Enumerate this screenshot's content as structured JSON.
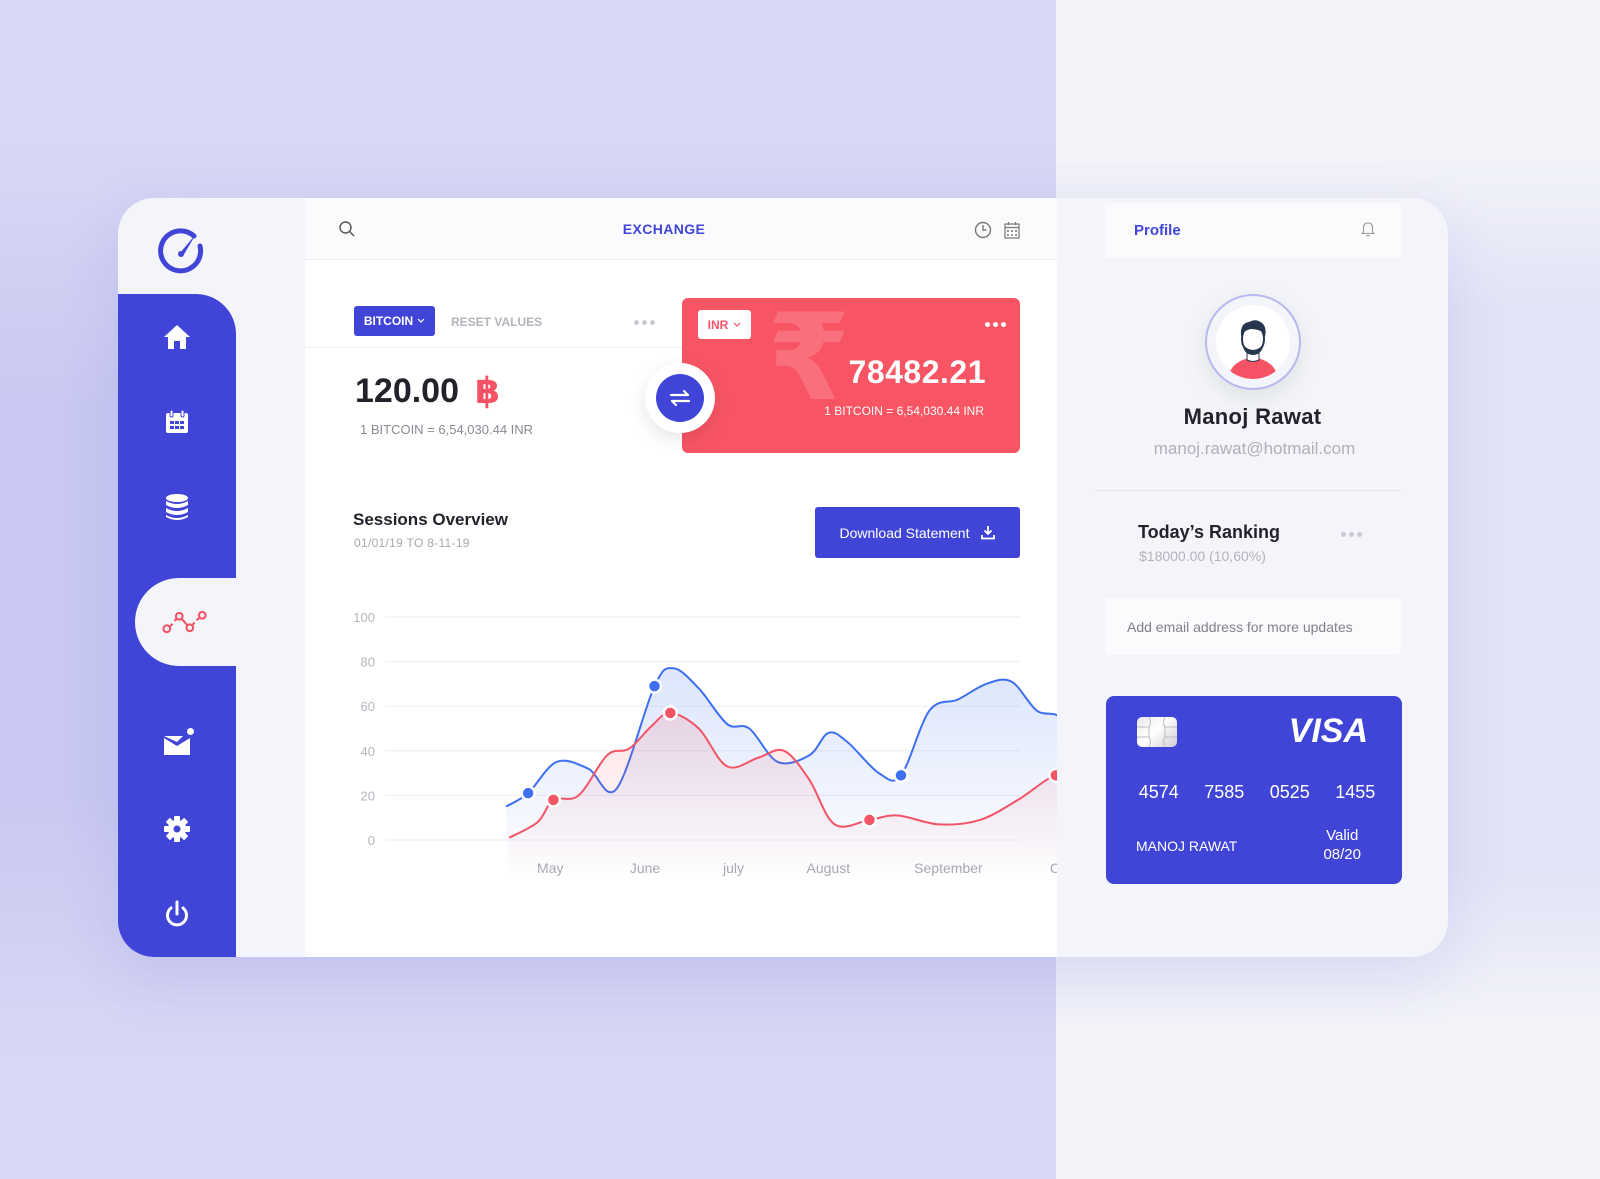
{
  "app": {
    "title": "EXCHANGE"
  },
  "sidebar": {
    "items": [
      {
        "name": "home",
        "icon": "home-icon"
      },
      {
        "name": "calendar",
        "icon": "calendar-icon"
      },
      {
        "name": "database",
        "icon": "database-icon"
      },
      {
        "name": "analytics",
        "icon": "line-chart-icon",
        "active": true
      },
      {
        "name": "mail",
        "icon": "mail-icon",
        "has_notification": true
      },
      {
        "name": "settings",
        "icon": "gear-icon"
      },
      {
        "name": "logout",
        "icon": "power-icon"
      }
    ]
  },
  "exchange": {
    "from_currency": "BITCOIN",
    "reset_label": "RESET VALUES",
    "from_amount": "120.00",
    "from_symbol": "฿",
    "from_rate": "1 BITCOIN = 6,54,030.44 INR",
    "to_currency": "INR",
    "to_amount": "78482.21",
    "to_rate": "1 BITCOIN = 6,54,030.44 INR",
    "to_symbol": "₹"
  },
  "sessions": {
    "title": "Sessions Overview",
    "range": "01/01/19  TO  8-11-19",
    "download_label": "Download Statement"
  },
  "chart_data": {
    "type": "line",
    "title": "Sessions Overview",
    "xlabel": "",
    "ylabel": "",
    "ylim": [
      0,
      100
    ],
    "yticks": [
      0,
      20,
      40,
      60,
      80,
      100
    ],
    "grid": true,
    "categories": [
      "May",
      "June",
      "july",
      "August",
      "September",
      "October"
    ],
    "xlim": [
      0,
      100
    ],
    "category_positions": [
      7,
      22,
      36,
      51,
      70,
      90
    ],
    "series": [
      {
        "name": "blue",
        "color": "#3d6ff0",
        "x": [
          0,
          3.5,
          8,
          13,
          17.5,
          23.5,
          26.5,
          30.5,
          35,
          38.5,
          43,
          48,
          51,
          54,
          59,
          62.5,
          67,
          71.5,
          76,
          80,
          84,
          88,
          91.5,
          95,
          100
        ],
        "y": [
          15,
          21,
          35,
          32,
          23,
          69,
          77,
          68,
          52,
          50,
          35,
          38,
          48,
          44,
          30,
          29,
          58,
          63,
          70,
          71,
          58,
          54,
          31,
          18,
          15
        ],
        "markers": [
          1,
          5,
          15,
          22
        ]
      },
      {
        "name": "red",
        "color": "#f25565",
        "x": [
          0.5,
          5,
          7.5,
          11.5,
          16,
          19.5,
          23,
          26,
          30.5,
          35,
          40,
          44,
          48,
          52,
          57.5,
          62,
          68.5,
          75,
          81,
          87,
          90.5,
          95,
          98
        ],
        "y": [
          1,
          8,
          18,
          20,
          38,
          41,
          51,
          57,
          50,
          33,
          37,
          40,
          27,
          7,
          9,
          11,
          7,
          9,
          18,
          29,
          26,
          15,
          11
        ],
        "markers": [
          2,
          7,
          14,
          19
        ]
      }
    ]
  },
  "profile": {
    "header_label": "Profile",
    "name": "Manoj Rawat",
    "email": "manoj.rawat@hotmail.com",
    "ranking_title": "Today’s Ranking",
    "ranking_value": "$18000.00 (10,60%)",
    "email_placeholder": "Add email address for more updates"
  },
  "card": {
    "brand": "VISA",
    "number_groups": [
      "4574",
      "7585",
      "0525",
      "1455"
    ],
    "holder": "MANOJ RAWAT",
    "valid_label": "Valid",
    "valid_value": "08/20"
  },
  "colors": {
    "primary": "#4145d7",
    "accent_red": "#f85564",
    "background": "#d9d9f5"
  }
}
